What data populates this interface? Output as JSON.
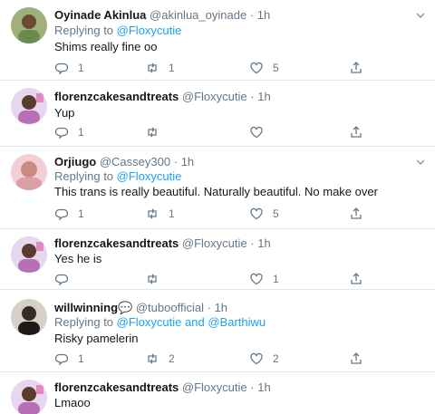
{
  "tweets": [
    {
      "name": "Oyinade Akinlua",
      "handle": "@akinlua_oyinade",
      "dot": "·",
      "time": "1h",
      "reply_prefix": "Replying to",
      "mentions": [
        "@Floxycutie"
      ],
      "mention_joiner": "",
      "text": "Shims really fine oo",
      "replies": "1",
      "retweets": "1",
      "likes": "5",
      "avatar_color": "#6b8a52"
    },
    {
      "name": "florenzcakesandtreats",
      "handle": "@Floxycutie",
      "dot": "·",
      "time": "1h",
      "reply_prefix": "",
      "mentions": [],
      "text": "Yup",
      "replies": "1",
      "retweets": "",
      "likes": "",
      "avatar_color": "#c7a9d8"
    },
    {
      "name": "Orjiugo",
      "handle": "@Cassey300",
      "dot": "·",
      "time": "1h",
      "reply_prefix": "Replying to",
      "mentions": [
        "@Floxycutie"
      ],
      "mention_joiner": "",
      "text": "This trans is really beautiful. Naturally beautiful. No make over",
      "replies": "1",
      "retweets": "1",
      "likes": "5",
      "avatar_color": "#d9a0a6"
    },
    {
      "name": "florenzcakesandtreats",
      "handle": "@Floxycutie",
      "dot": "·",
      "time": "1h",
      "reply_prefix": "",
      "mentions": [],
      "text": "Yes he is",
      "replies": "",
      "retweets": "",
      "likes": "1",
      "avatar_color": "#c7a9d8"
    },
    {
      "name": "willwinning",
      "name_emoji": "💬",
      "handle": "@tuboofficial",
      "dot": "·",
      "time": "1h",
      "reply_prefix": "Replying to",
      "mentions": [
        "@Floxycutie",
        "@Barthiwu"
      ],
      "mention_joiner": "and",
      "text": "Risky pamelerin",
      "replies": "1",
      "retweets": "2",
      "likes": "2",
      "avatar_color": "#3a2a24"
    },
    {
      "name": "florenzcakesandtreats",
      "handle": "@Floxycutie",
      "dot": "·",
      "time": "1h",
      "reply_prefix": "",
      "mentions": [],
      "text": "Lmaoo",
      "replies": "",
      "retweets": "",
      "likes": "",
      "avatar_color": "#c7a9d8"
    }
  ],
  "colors": {
    "accent": "#1da1f2",
    "muted": "#657786",
    "divider": "#e1e8ed"
  },
  "icons": [
    "reply-icon",
    "retweet-icon",
    "like-icon",
    "share-icon",
    "caret-down-icon"
  ]
}
